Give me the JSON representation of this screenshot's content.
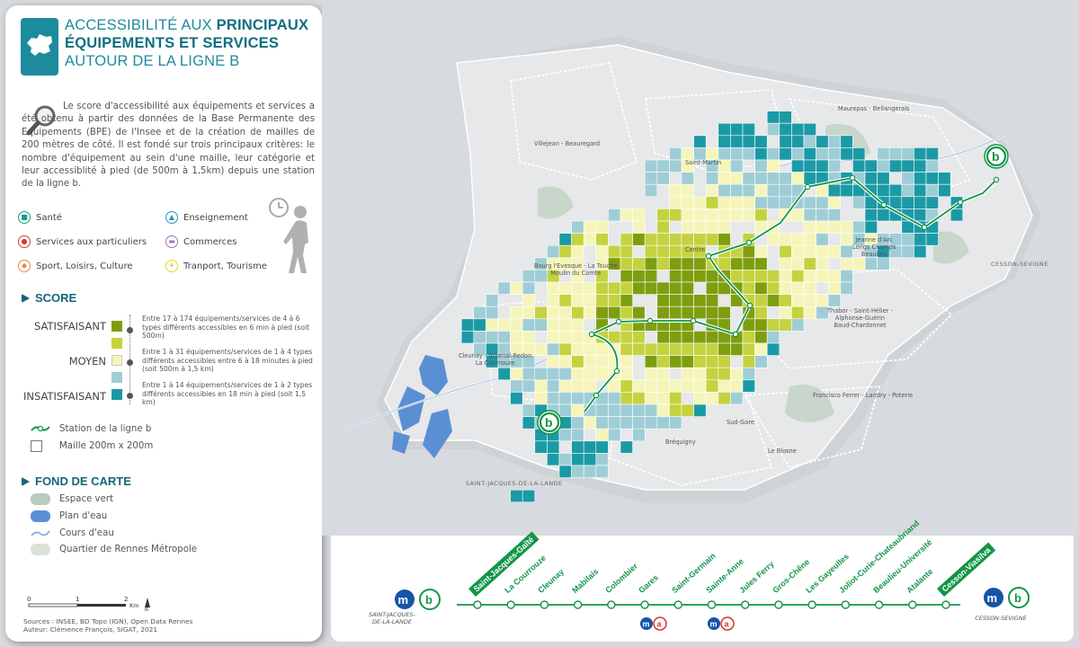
{
  "panel": {
    "title_part1": "Accessibilité aux ",
    "title_bold1": "principaux équipements et services",
    "title_part2": " autour de la ligne b",
    "intro": "Le score d'accessibilité aux équipements et services a été obtenu à partir des données de la Base Permanente des Equipements (BPE) de l'Insee et de la création de mailles de 200 mètres de côté. Il est fondé sur trois principaux critères: le nombre d'équipement au sein d'une maille, leur catégorie et leur accessiblité à pied (de 500m à 1,5km) depuis une station de la ligne b.",
    "categories": [
      {
        "label": "Santé",
        "color": "#1a9b8c",
        "icon": "health-icon"
      },
      {
        "label": "Enseignement",
        "color": "#2c8fb8",
        "icon": "education-icon"
      },
      {
        "label": "Services aux particuliers",
        "color": "#d23a3a",
        "icon": "services-icon"
      },
      {
        "label": "Commerces",
        "color": "#9a78b8",
        "icon": "shop-icon"
      },
      {
        "label": "Sport, Loisirs, Culture",
        "color": "#e8864a",
        "icon": "sport-icon"
      },
      {
        "label": "Tranport, Tourisme",
        "color": "#e3d52a",
        "icon": "transport-icon"
      }
    ],
    "score_heading": "SCORE",
    "score_levels": [
      {
        "label": "SATISFAISANT",
        "desc": "Entre 17 à 174 équipements/services de 4 à 6 types différents accessibles en 6 min à pied (soit 500m)"
      },
      {
        "label": "MOYEN",
        "desc": "Entre 1 à 31 équipements/services de 1 à 4 types différents accessibles entre 6 à 18 minutes à pied (soit 500m à 1,5 km)"
      },
      {
        "label": "INSATISFAISANT",
        "desc": "Entre 1 à 14 équipements/services de 1 à 2 types différents accessibles en 18 min à pied (soit 1,5 km)"
      }
    ],
    "score_colors": [
      "#7e9e10",
      "#c4d23f",
      "#f5f5bb",
      "#9fcdd6",
      "#1b9aa6"
    ],
    "station_label": "Station de la ligne b",
    "cell_label": "Maille 200m x 200m",
    "fond_heading": "FOND DE CARTE",
    "fond_items": [
      {
        "label": "Espace vert",
        "color": "#b7cbbf"
      },
      {
        "label": "Plan d'eau",
        "color": "#5b8fd4"
      },
      {
        "label": "Cours d'eau",
        "color": "#7ea6d8"
      },
      {
        "label": "Quartier de Rennes Métropole",
        "color": "#dde2d6"
      }
    ],
    "scale": {
      "t0": "0",
      "t1": "1",
      "t2": "2",
      "unit": "Km",
      "north": "N"
    },
    "sources_line1": "Sources : INSEE, BD Topo (IGN), Open Data Rennes",
    "sources_line2": "Auteur: Clémence François, SIGAT, 2021"
  },
  "map": {
    "labels": {
      "villejean": "Villejean - Beauregard",
      "maurepas": "Maurepas - Bellangerais",
      "saint_martin": "Saint-Martin",
      "centre": "Centre",
      "bourg_leveque": "Bourg l'Evesque - La Touche\nMoulin du Comte",
      "jeanne_arc": "Jeanne d'Arc\nLongs Champs\nBeaulieu",
      "cesson": "CESSON-SEVIGNE",
      "thabor": "Thabor - Saint-Hélier -\nAlphonse-Guérin\nBaud-Chardonnet",
      "cleunay": "Cleunay - Arsenal-Redon\nLa Courrouze",
      "francisco": "Francisco Ferrer - Landry - Poterie",
      "sud_gare": "Sud-Gare",
      "brequigny": "Bréquigny",
      "blosne": "Le Blosne",
      "sjdl": "SAINT-JACQUES-DE-LA-LANDE"
    },
    "line_label": "b"
  },
  "strip": {
    "stations": [
      "Saint-Jacques-Gaîté",
      "La Courrouze",
      "Cleunay",
      "Mabilais",
      "Colombier",
      "Gares",
      "Saint-Germain",
      "Sainte-Anne",
      "Jules Ferry",
      "Gros-Chêne",
      "Les Gayeulles",
      "Joliot-Curie-Chateaubriand",
      "Beaulieu-Université",
      "Atalante",
      "Cesson-Viasilva"
    ],
    "start_city": "SAINT-JACQUES-\nDE-LA-LANDE",
    "end_city": "CESSON-SEVIGNE",
    "metro_m": "m",
    "metro_a": "a",
    "metro_b": "b",
    "line_color": "#139548"
  }
}
